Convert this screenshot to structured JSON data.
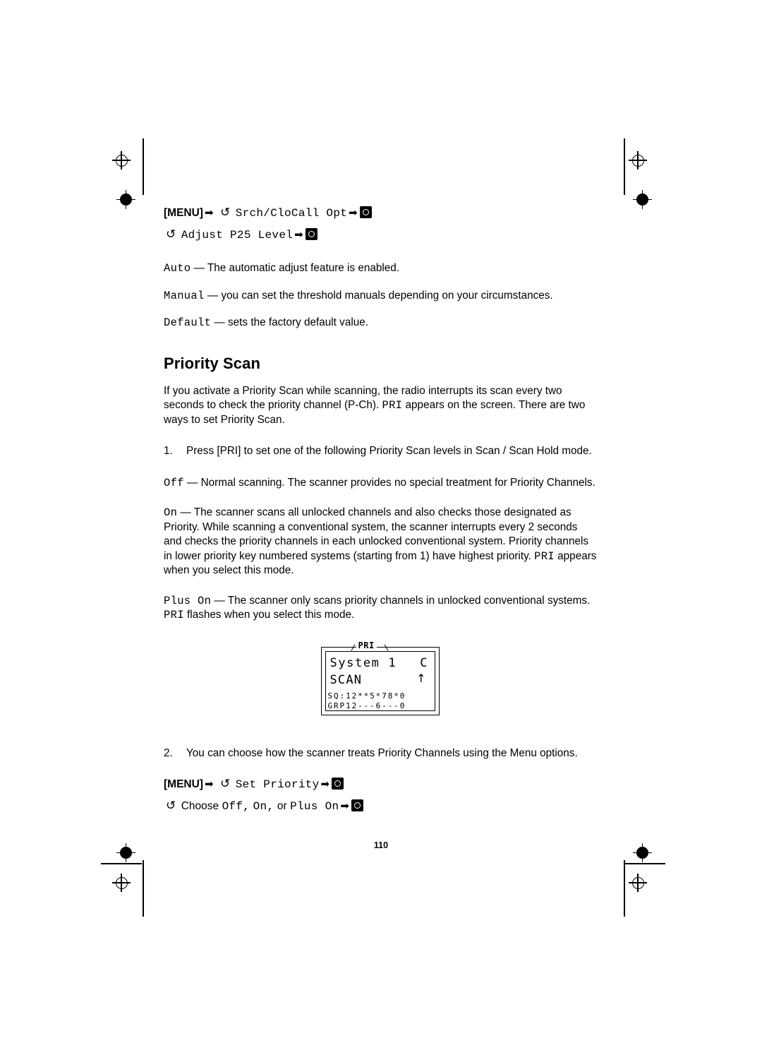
{
  "page": {
    "number": "110"
  },
  "nav_top": {
    "menu_label": "[MENU]",
    "item1": "Srch/CloCall Opt",
    "item2": "Adjust P25 Level"
  },
  "options_top": [
    {
      "term": "Auto",
      "desc": " — The automatic adjust feature is enabled."
    },
    {
      "term": "Manual",
      "desc": " — you can set the threshold manuals depending on your circumstances."
    },
    {
      "term": "Default",
      "desc": " — sets the factory default value."
    }
  ],
  "section": {
    "heading": "Priority Scan",
    "intro_part1": "If you activate a Priority Scan while scanning, the radio interrupts its scan every two seconds to check the priority channel (P-Ch). ",
    "intro_pri": "PRI",
    "intro_part2": " appears on the screen. There are two ways to set Priority Scan."
  },
  "step1": {
    "number": "1.",
    "text_part1": "Press ",
    "key": "[PRI]",
    "text_part2": " to set one of the following Priority Scan levels in Scan / Scan Hold mode."
  },
  "levels": [
    {
      "term": "Off",
      "desc": " — Normal scanning. The scanner provides no special treatment for Priority Channels."
    },
    {
      "term": "On",
      "desc_part1": " — The scanner scans all unlocked channels and also checks those designated as Priority. While scanning a conventional system, the scanner interrupts every 2 seconds and checks the priority channels in each unlocked conventional system. Priority channels in lower priority key numbered systems (starting from 1) have highest priority. ",
      "desc_mono": "PRI",
      "desc_part2": " appears when you select this mode."
    },
    {
      "term": "Plus On",
      "desc_part1": " — The scanner only scans priority channels in unlocked conventional systems. ",
      "desc_mono": "PRI",
      "desc_part2": " flashes when you select this mode."
    }
  ],
  "lcd": {
    "badge": "PRI",
    "line1": "System 1",
    "corner": "C",
    "line2": "SCAN",
    "uparrow": "↑",
    "line3": "SQ:12**5*78*0",
    "line4": "GRP12---6---0"
  },
  "step2": {
    "number": "2.",
    "text": "You can choose how the scanner treats Priority Channels using the Menu options."
  },
  "nav_bottom": {
    "menu_label": "[MENU]",
    "item1": "Set Priority",
    "choose_label": "Choose",
    "opt1": "Off,",
    "opt2": "On,",
    "or_label": "or",
    "opt3": "Plus On"
  }
}
